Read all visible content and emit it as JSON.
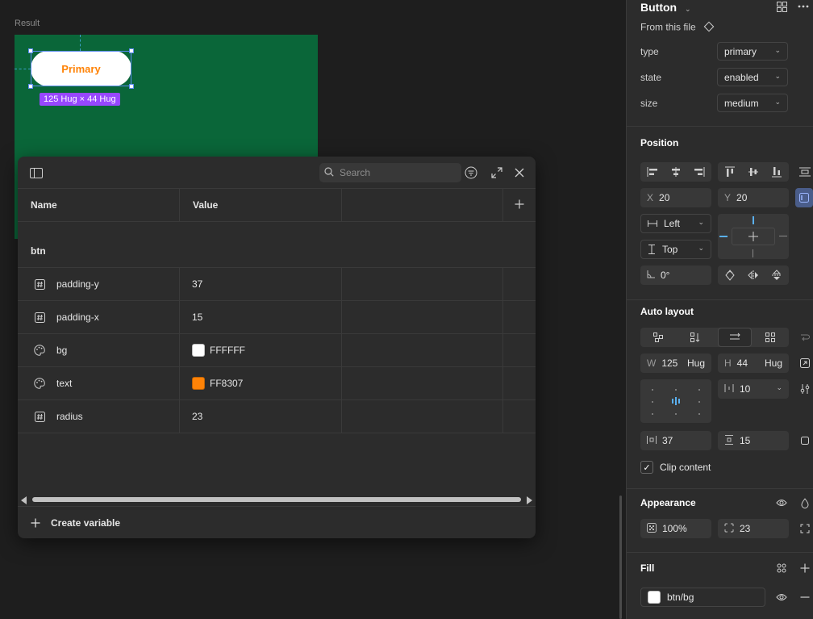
{
  "canvas": {
    "result_label": "Result",
    "button_label": "Primary",
    "size_badge": "125 Hug × 44 Hug",
    "colors": {
      "frame_bg": "#0a6639",
      "button_bg": "#FFFFFF",
      "button_text": "#FF8307",
      "selection": "#5b8cf0",
      "badge": "#9747ff"
    }
  },
  "variables": {
    "search_placeholder": "Search",
    "columns": {
      "name": "Name",
      "value": "Value"
    },
    "group": "btn",
    "rows": [
      {
        "type": "number",
        "icon": "number-variable-icon",
        "name": "padding-y",
        "value": "37"
      },
      {
        "type": "color",
        "icon": "color-variable-icon",
        "name": "padding-x",
        "value": "15"
      },
      {
        "type": "color",
        "icon": "palette-icon",
        "name": "bg",
        "value": "FFFFFF",
        "swatch": "#FFFFFF"
      },
      {
        "type": "color",
        "icon": "palette-icon",
        "name": "text",
        "value": "FF8307",
        "swatch": "#FF8307"
      },
      {
        "type": "number",
        "icon": "number-variable-icon",
        "name": "radius",
        "value": "23"
      }
    ],
    "create_label": "Create variable"
  },
  "panel": {
    "component_name": "Button",
    "source": "From this file",
    "props": [
      {
        "label": "type",
        "value": "primary"
      },
      {
        "label": "state",
        "value": "enabled"
      },
      {
        "label": "size",
        "value": "medium"
      }
    ],
    "position": {
      "title": "Position",
      "x_label": "X",
      "x": "20",
      "y_label": "Y",
      "y": "20",
      "h_constraint": "Left",
      "v_constraint": "Top",
      "rotation": "0°"
    },
    "auto_layout": {
      "title": "Auto layout",
      "w_label": "W",
      "w": "125",
      "w_mode": "Hug",
      "h_label": "H",
      "h": "44",
      "h_mode": "Hug",
      "gap": "10",
      "padding_h": "37",
      "padding_v": "15",
      "clip_label": "Clip content"
    },
    "appearance": {
      "title": "Appearance",
      "opacity": "100%",
      "radius": "23"
    },
    "fill": {
      "title": "Fill",
      "variable": "btn/bg",
      "swatch": "#FFFFFF"
    }
  }
}
